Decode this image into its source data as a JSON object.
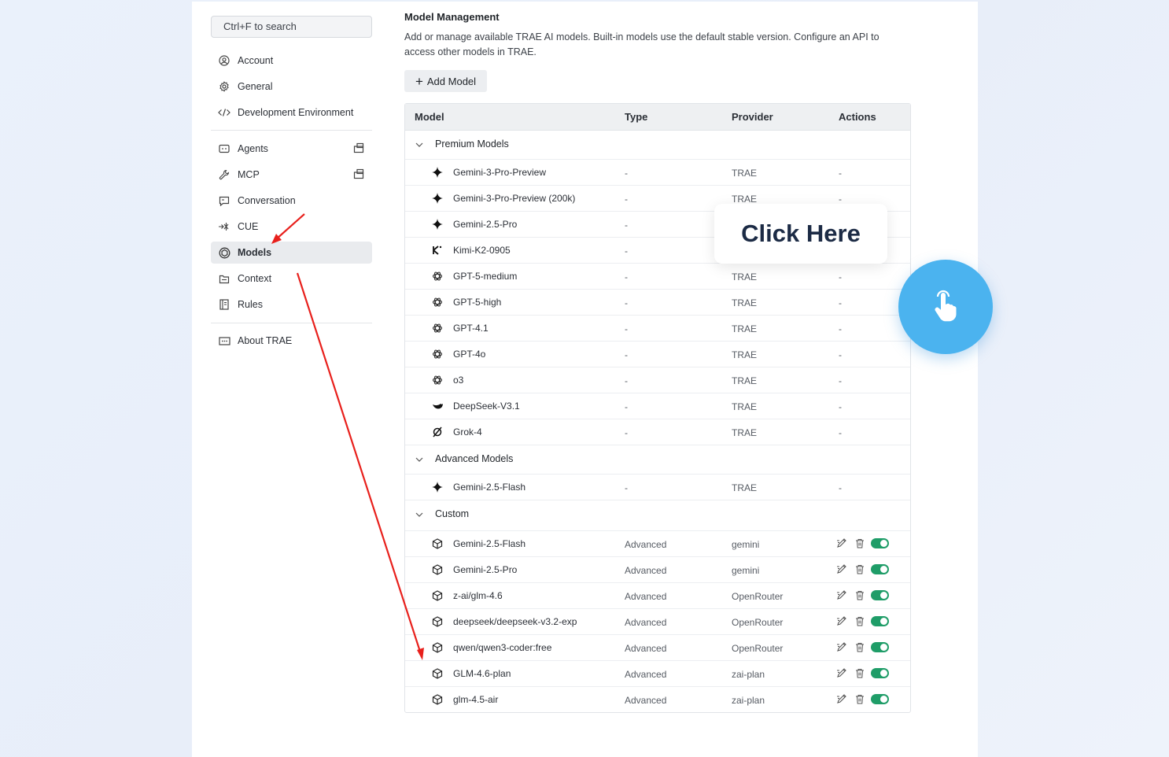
{
  "sidebar": {
    "search_placeholder": "Ctrl+F to search",
    "items": [
      {
        "label": "Account",
        "icon": "account-icon"
      },
      {
        "label": "General",
        "icon": "gear-icon"
      },
      {
        "label": "Development Environment",
        "icon": "code-icon"
      },
      {
        "label": "Agents",
        "icon": "agent-icon"
      },
      {
        "label": "MCP",
        "icon": "wrench-icon"
      },
      {
        "label": "Conversation",
        "icon": "chat-icon"
      },
      {
        "label": "CUE",
        "icon": "cue-icon"
      },
      {
        "label": "Models",
        "icon": "models-icon",
        "active": true
      },
      {
        "label": "Context",
        "icon": "context-icon"
      },
      {
        "label": "Rules",
        "icon": "rules-icon"
      },
      {
        "label": "About TRAE",
        "icon": "info-icon"
      }
    ]
  },
  "main": {
    "title": "Model Management",
    "description": "Add or manage available TRAE AI models. Built-in models use the default stable version. Configure an API to access other models in TRAE.",
    "add_button": "Add Model"
  },
  "table": {
    "headers": {
      "model": "Model",
      "type": "Type",
      "provider": "Provider",
      "actions": "Actions"
    },
    "groups": [
      {
        "label": "Premium Models",
        "rows": [
          {
            "name": "Gemini-3-Pro-Preview",
            "icon": "gemini-sparkle-icon",
            "type": "-",
            "provider": "TRAE",
            "actions": "-"
          },
          {
            "name": "Gemini-3-Pro-Preview (200k)",
            "icon": "gemini-sparkle-icon",
            "type": "-",
            "provider": "TRAE",
            "actions": "-"
          },
          {
            "name": "Gemini-2.5-Pro",
            "icon": "gemini-sparkle-icon",
            "type": "-",
            "provider": "",
            "actions": ""
          },
          {
            "name": "Kimi-K2-0905",
            "icon": "kimi-icon",
            "type": "-",
            "provider": "",
            "actions": ""
          },
          {
            "name": "GPT-5-medium",
            "icon": "openai-icon",
            "type": "-",
            "provider": "TRAE",
            "actions": "-"
          },
          {
            "name": "GPT-5-high",
            "icon": "openai-icon",
            "type": "-",
            "provider": "TRAE",
            "actions": "-"
          },
          {
            "name": "GPT-4.1",
            "icon": "openai-icon",
            "type": "-",
            "provider": "TRAE",
            "actions": "-"
          },
          {
            "name": "GPT-4o",
            "icon": "openai-icon",
            "type": "-",
            "provider": "TRAE",
            "actions": "-"
          },
          {
            "name": "o3",
            "icon": "openai-icon",
            "type": "-",
            "provider": "TRAE",
            "actions": "-"
          },
          {
            "name": "DeepSeek-V3.1",
            "icon": "deepseek-icon",
            "type": "-",
            "provider": "TRAE",
            "actions": "-"
          },
          {
            "name": "Grok-4",
            "icon": "grok-icon",
            "type": "-",
            "provider": "TRAE",
            "actions": "-"
          }
        ]
      },
      {
        "label": "Advanced Models",
        "rows": [
          {
            "name": "Gemini-2.5-Flash",
            "icon": "gemini-sparkle-icon",
            "type": "-",
            "provider": "TRAE",
            "actions": "-"
          }
        ]
      },
      {
        "label": "Custom",
        "rows": [
          {
            "name": "Gemini-2.5-Flash",
            "icon": "cube-icon",
            "type": "Advanced",
            "provider": "gemini",
            "enabled": true
          },
          {
            "name": "Gemini-2.5-Pro",
            "icon": "cube-icon",
            "type": "Advanced",
            "provider": "gemini",
            "enabled": true
          },
          {
            "name": "z-ai/glm-4.6",
            "icon": "cube-icon",
            "type": "Advanced",
            "provider": "OpenRouter",
            "enabled": true
          },
          {
            "name": "deepseek/deepseek-v3.2-exp",
            "icon": "cube-icon",
            "type": "Advanced",
            "provider": "OpenRouter",
            "enabled": true
          },
          {
            "name": "qwen/qwen3-coder:free",
            "icon": "cube-icon",
            "type": "Advanced",
            "provider": "OpenRouter",
            "enabled": true
          },
          {
            "name": "GLM-4.6-plan",
            "icon": "cube-icon",
            "type": "Advanced",
            "provider": "zai-plan",
            "enabled": true
          },
          {
            "name": "glm-4.5-air",
            "icon": "cube-icon",
            "type": "Advanced",
            "provider": "zai-plan",
            "enabled": true
          }
        ]
      }
    ]
  },
  "overlay": {
    "tooltip_text": "Click Here",
    "hand_color": "#4bb3ef",
    "arrow_color": "#e8201c",
    "toggle_color": "#1f9d68"
  }
}
